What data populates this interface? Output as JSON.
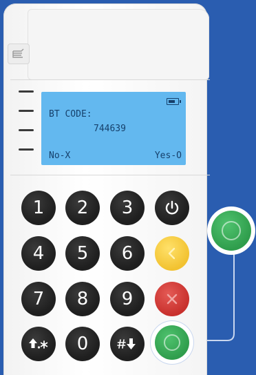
{
  "lcd": {
    "line1": "BT CODE:",
    "line2": "744639",
    "left_soft": "No-X",
    "right_soft": "Yes-O",
    "battery_icon": "battery-icon"
  },
  "keypad": {
    "k1": "1",
    "k2": "2",
    "k3": "3",
    "k4": "4",
    "k5": "5",
    "k6": "6",
    "k7": "7",
    "k8": "8",
    "k9": "9",
    "k0": "0",
    "shift_symbol": "⇧.*",
    "hash_symbol": "#⬇"
  },
  "colors": {
    "background": "#2a5db0",
    "lcd": "#63b8ef",
    "confirm": "#2f9d4c",
    "correct": "#f2c230",
    "cancel": "#c8302c"
  }
}
